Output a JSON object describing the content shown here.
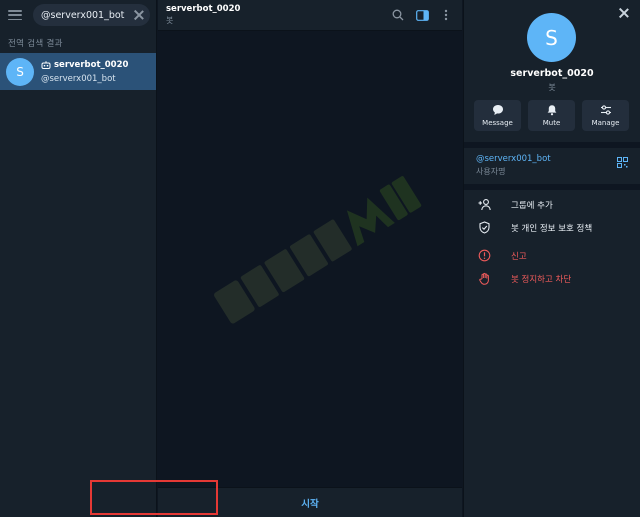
{
  "search": {
    "value": "@serverx001_bot"
  },
  "left": {
    "section_label": "전역 검색 결과",
    "result": {
      "avatar_letter": "S",
      "name": "serverbot_0020",
      "username": "@serverx001_bot"
    }
  },
  "chat": {
    "title": "serverbot_0020",
    "subtitle": "봇",
    "start_label": "시작",
    "watermark_icon": "serverMon-logo"
  },
  "profile": {
    "avatar_letter": "S",
    "name": "serverbot_0020",
    "subtitle": "봇",
    "actions": [
      {
        "label": "Message",
        "icon": "message-icon"
      },
      {
        "label": "Mute",
        "icon": "bell-icon"
      },
      {
        "label": "Manage",
        "icon": "sliders-icon"
      }
    ],
    "username": "@serverx001_bot",
    "username_label": "사용자명",
    "menu": [
      {
        "label": "그룹에 추가",
        "icon": "add-user-icon"
      },
      {
        "label": "봇 개인 정보 보호 정책",
        "icon": "shield-check-icon"
      },
      {
        "label": "신고",
        "icon": "alert-icon"
      },
      {
        "label": "봇 정지하고 차단",
        "icon": "hand-stop-icon"
      }
    ]
  },
  "colors": {
    "accent": "#5eb5f7",
    "danger": "#ef5b5b",
    "selected": "#2b5278",
    "highlight": "#e53935"
  }
}
